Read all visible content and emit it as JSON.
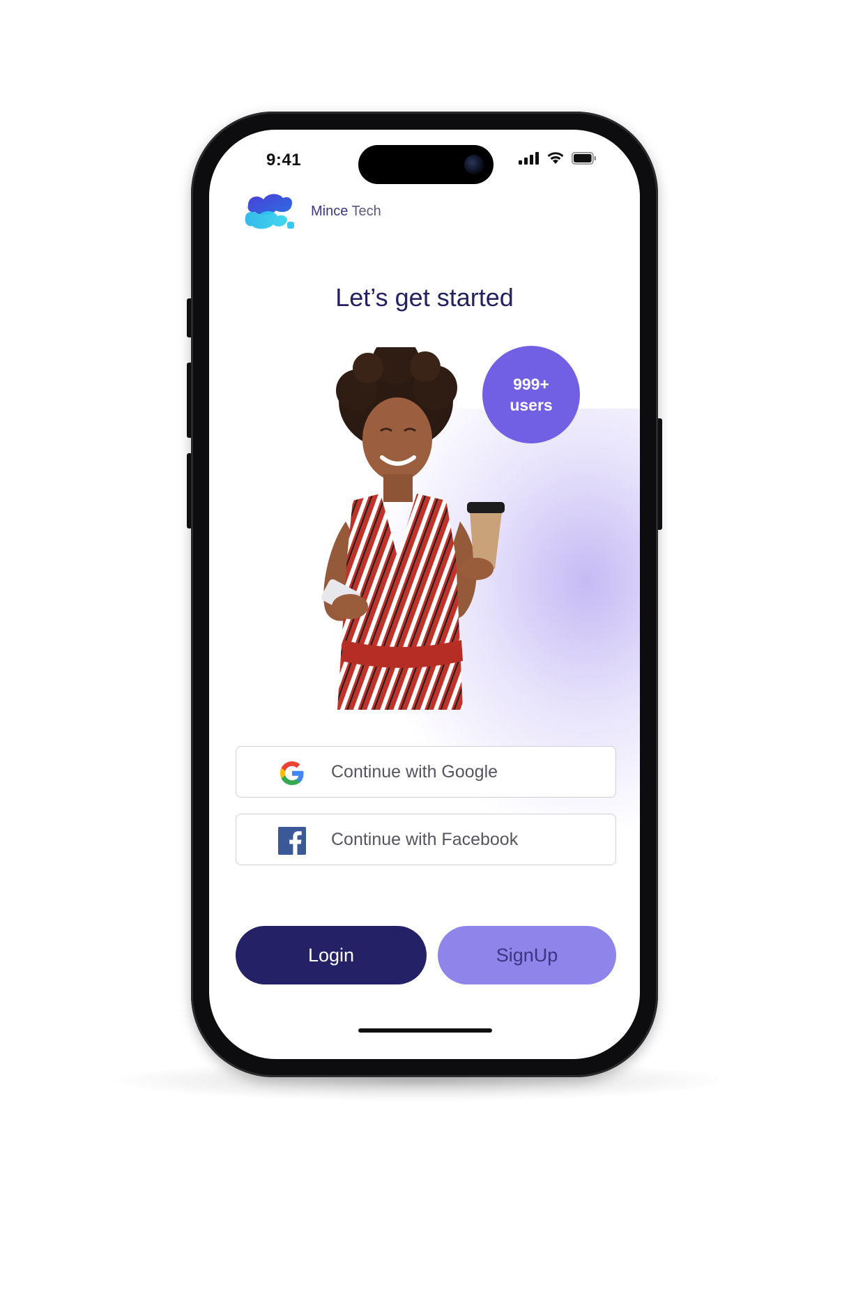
{
  "status_bar": {
    "time": "9:41",
    "icons": [
      "cellular-signal-icon",
      "wifi-icon",
      "battery-icon"
    ]
  },
  "brand": {
    "name_part1": "Mince",
    "name_part2": " Tech",
    "logo_icon": "cloud-logo-icon"
  },
  "headline": "Let’s get started",
  "badge": {
    "line1": "999+",
    "line2": "users"
  },
  "social": {
    "google_label": "Continue with Google",
    "facebook_label": "Continue with Facebook"
  },
  "actions": {
    "login_label": "Login",
    "signup_label": "SignUp"
  },
  "colors": {
    "primary_dark": "#252166",
    "primary_light": "#8e84ea",
    "badge": "#7160e3",
    "headline": "#23215e"
  }
}
